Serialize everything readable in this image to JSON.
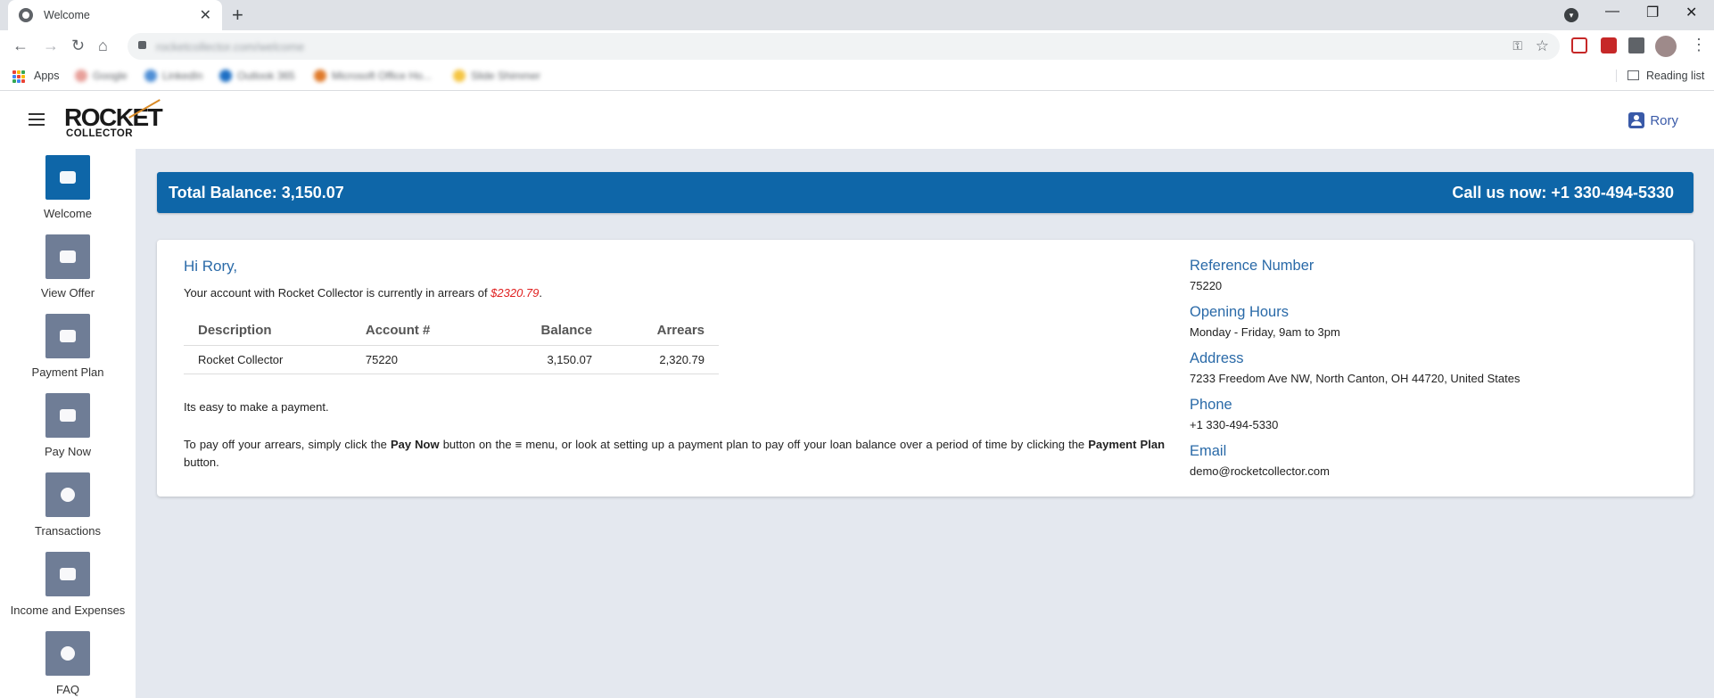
{
  "browser": {
    "tab_title": "Welcome",
    "tab_close": "✕",
    "new_tab": "+",
    "url": "rocketcollector.com/welcome",
    "bookmarks": {
      "apps_label": "Apps",
      "blurred": [
        "Google",
        "LinkedIn",
        "Outlook 365",
        "Microsoft Office Ho...",
        "Slide Shimmer"
      ],
      "reading_list": "Reading list"
    }
  },
  "header": {
    "logo_top": "ROCKET",
    "logo_sub": "COLLECTOR",
    "user_name": "Rory"
  },
  "sidebar": {
    "items": [
      {
        "label": "Welcome",
        "icon": "handshake-icon",
        "active": true
      },
      {
        "label": "View Offer",
        "icon": "briefcase-icon",
        "active": false
      },
      {
        "label": "Payment Plan",
        "icon": "card-icon",
        "active": false
      },
      {
        "label": "Pay Now",
        "icon": "credit-card-icon",
        "active": false
      },
      {
        "label": "Transactions",
        "icon": "user-circle-icon",
        "active": false
      },
      {
        "label": "Income and Expenses",
        "icon": "money-icon",
        "active": false
      },
      {
        "label": "FAQ",
        "icon": "question-icon",
        "active": false
      }
    ]
  },
  "balance_bar": {
    "total_label": "Total Balance: 3,150.07",
    "call_label": "Call us now: +1 330-494-5330"
  },
  "card": {
    "greeting": "Hi Rory,",
    "intro_prefix": "Your account with Rocket Collector is currently in arrears of ",
    "intro_amount": "$2320.79",
    "intro_suffix": ".",
    "table": {
      "headers": [
        "Description",
        "Account #",
        "Balance",
        "Arrears"
      ],
      "rows": [
        [
          "Rocket Collector",
          "75220",
          "3,150.07",
          "2,320.79"
        ]
      ]
    },
    "easy_text": "Its easy to make a payment.",
    "instr": {
      "p1": "To pay off your arrears, simply click the ",
      "b1": "Pay Now",
      "p2": " button on the ",
      "menu_glyph": "≡",
      "p3": " menu, or look at setting up a payment plan to pay off your loan balance over a period of time by clicking the ",
      "b2": "Payment Plan",
      "p4": " button."
    }
  },
  "contact": {
    "reference_label": "Reference Number",
    "reference_value": "75220",
    "hours_label": "Opening Hours",
    "hours_value": "Monday - Friday, 9am to 3pm",
    "address_label": "Address",
    "address_value": "7233 Freedom Ave NW, North Canton, OH 44720, United States",
    "phone_label": "Phone",
    "phone_value": "+1 330-494-5330",
    "email_label": "Email",
    "email_value": "demo@rocketcollector.com"
  },
  "colors": {
    "primary": "#0e66a8",
    "nav_inactive": "#6f7d96",
    "arrears_red": "#e02020",
    "heading_blue": "#2a6aa8",
    "main_bg": "#e4e8ef"
  }
}
